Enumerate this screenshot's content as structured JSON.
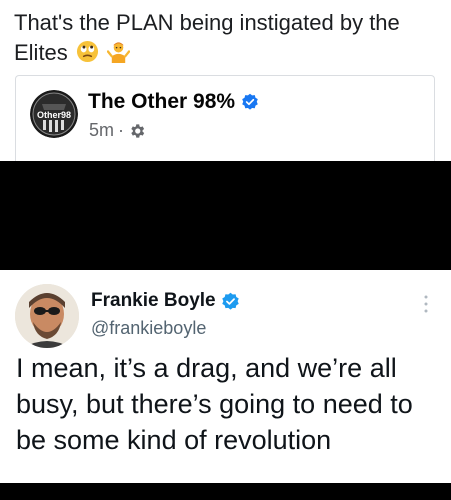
{
  "post": {
    "text": "That's the PLAN being instigated by the Elites",
    "emojis": [
      "face-with-rolling-eyes-icon",
      "person-shrugging-icon"
    ]
  },
  "shared_page": {
    "avatar_text": "Other98",
    "name": "The Other 98%",
    "time": "5m",
    "separator": "·",
    "privacy_icon": "gear-icon"
  },
  "tweet": {
    "name": "Frankie Boyle",
    "handle": "@frankieboyle",
    "text": "I mean, it’s a drag, and we’re all busy, but there’s going to need to be some kind of revolution"
  },
  "colors": {
    "verified_fb": "#1877f2",
    "verified_tw": "#1d9bf0",
    "band": "#000000"
  }
}
